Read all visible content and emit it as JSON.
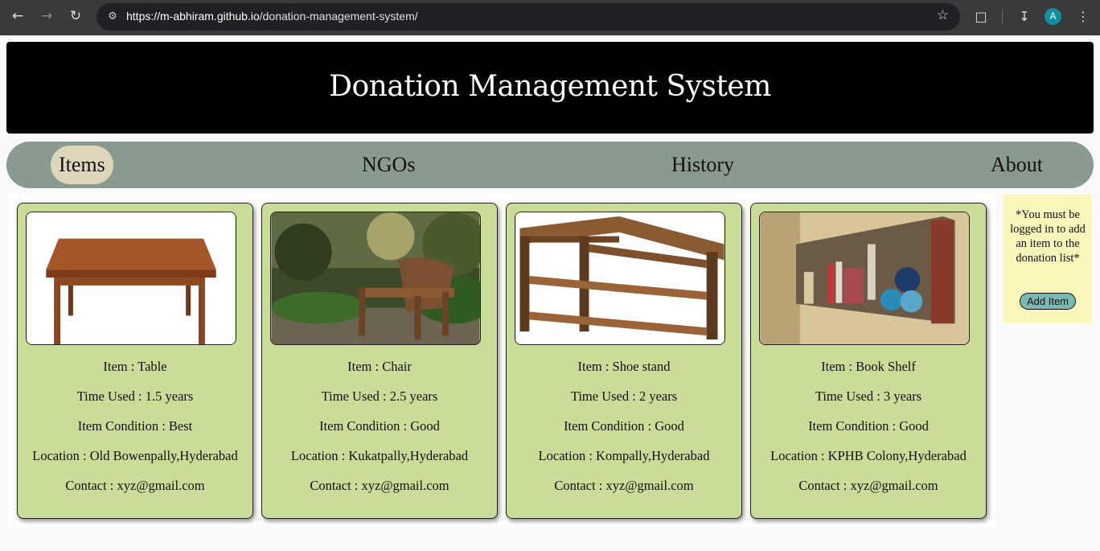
{
  "browser": {
    "url_host": "https://m-abhiram.github.io",
    "url_path": "/donation-management-system/",
    "profile_initial": "A",
    "icons": [
      "back-arrow-icon",
      "forward-arrow-icon",
      "reload-icon",
      "site-info-icon",
      "star-icon",
      "extensions-icon",
      "download-icon",
      "kebab-menu-icon"
    ]
  },
  "header": {
    "title": "Donation Management System"
  },
  "nav": {
    "items": [
      {
        "label": "Items",
        "active": true
      },
      {
        "label": "NGOs",
        "active": false
      },
      {
        "label": "History",
        "active": false
      },
      {
        "label": "About",
        "active": false
      }
    ]
  },
  "items": [
    {
      "item": "Item : Table",
      "time_used": "Time Used : 1.5 years",
      "condition": "Item Condition : Best",
      "location": "Location : Old Bowenpally,Hyderabad",
      "contact": "Contact : xyz@gmail.com"
    },
    {
      "item": "Item : Chair",
      "time_used": "Time Used : 2.5 years",
      "condition": "Item Condition : Good",
      "location": "Location : Kukatpally,Hyderabad",
      "contact": "Contact : xyz@gmail.com"
    },
    {
      "item": "Item : Shoe stand",
      "time_used": "Time Used : 2 years",
      "condition": "Item Condition : Good",
      "location": "Location : Kompally,Hyderabad",
      "contact": "Contact : xyz@gmail.com"
    },
    {
      "item": "Item : Book Shelf",
      "time_used": "Time Used : 3 years",
      "condition": "Item Condition : Good",
      "location": "Location : KPHB Colony,Hyderabad",
      "contact": "Contact : xyz@gmail.com"
    }
  ],
  "sidebar": {
    "note": "*You must be logged in to add an item to the donation list*",
    "add_button": "Add Item"
  },
  "colors": {
    "banner": "#000000",
    "navbar": "#8a9a8e",
    "nav_active": "#ded6bb",
    "card": "#c9dd98",
    "sidebar": "#f8f7b9",
    "add_button": "#7ab9b3"
  }
}
